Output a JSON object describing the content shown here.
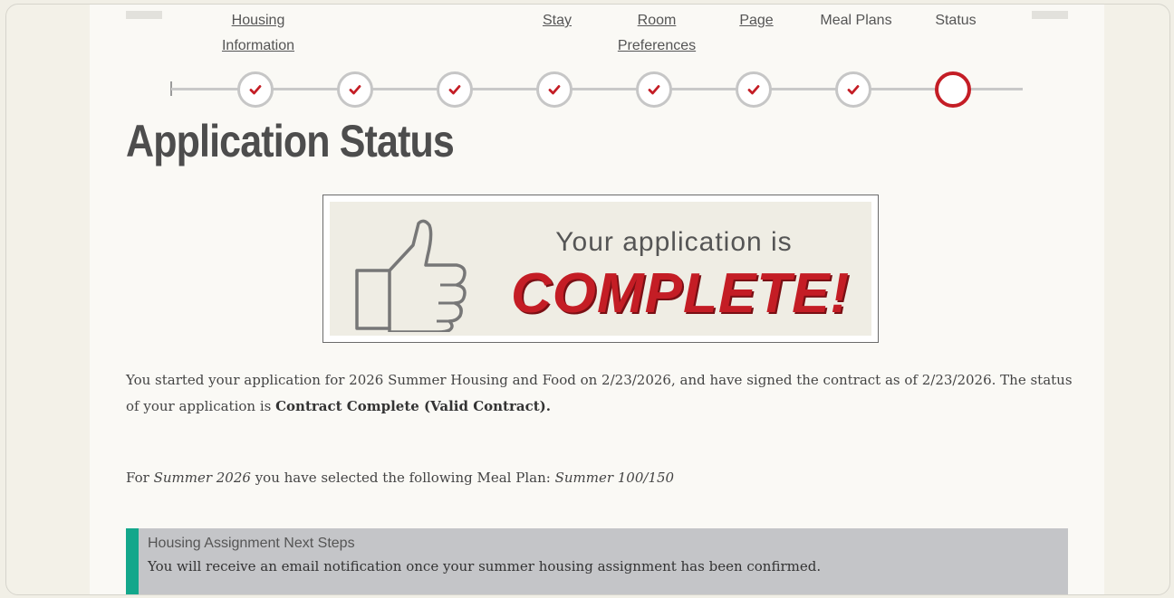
{
  "steps": [
    {
      "label_line1": "Housing",
      "label_line2": "Information",
      "link": true,
      "state": "done"
    },
    {
      "label_line1": "",
      "label_line2": "",
      "link": false,
      "state": "done"
    },
    {
      "label_line1": "",
      "label_line2": "",
      "link": false,
      "state": "done"
    },
    {
      "label_line1": "Stay",
      "label_line2": "",
      "link": true,
      "state": "done"
    },
    {
      "label_line1": "Room",
      "label_line2": "Preferences",
      "link": true,
      "state": "done"
    },
    {
      "label_line1": "Page",
      "label_line2": "",
      "link": true,
      "state": "done"
    },
    {
      "label_line1": "Meal Plans",
      "label_line2": "",
      "link": false,
      "state": "done"
    },
    {
      "label_line1": "Status",
      "label_line2": "",
      "link": false,
      "state": "current"
    }
  ],
  "page": {
    "title": "Application Status"
  },
  "banner": {
    "line1": "Your application is",
    "line2": "COMPLETE!",
    "icon": "thumbs-up-icon"
  },
  "status": {
    "text_before": "You started your application for 2026 Summer Housing and Food on 2/23/2026, and have signed the contract as of 2/23/2026. The status of your application is ",
    "status_value": "Contract Complete (Valid Contract)."
  },
  "meal": {
    "prefix": "For ",
    "term": "Summer 2026",
    "middle": " you have selected the following Meal Plan: ",
    "plan": "Summer 100/150"
  },
  "notice": {
    "title": "Housing Assignment Next Steps",
    "body": "You will receive an email notification once your summer housing assignment has been confirmed."
  },
  "colors": {
    "accent": "#c41d25",
    "notice_bar": "#13a78b",
    "check_icon": "check-icon"
  }
}
